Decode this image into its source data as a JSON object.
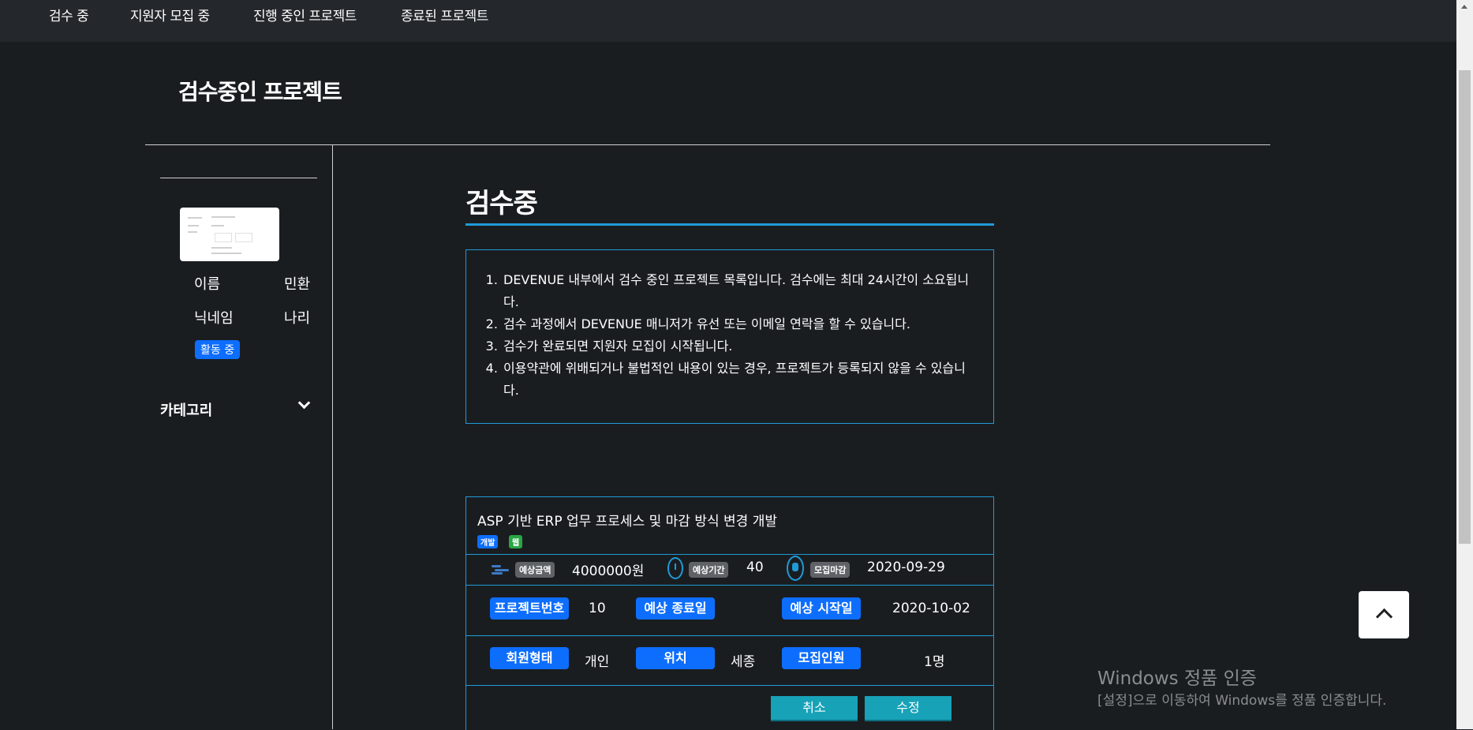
{
  "nav": {
    "items": [
      "검수 중",
      "지원자 모집 중",
      "진행 중인 프로젝트",
      "종료된 프로젝트"
    ]
  },
  "page": {
    "title": "검수중인 프로젝트"
  },
  "sidebar": {
    "profile": {
      "name_label": "이름",
      "name_value": "민환",
      "nickname_label": "닉네임",
      "nickname_value": "나리",
      "status": "활동 중"
    },
    "category_label": "카테고리"
  },
  "main": {
    "heading": "검수중",
    "info_items": [
      "DEVENUE 내부에서 검수 중인 프로젝트 목록입니다. 검수에는 최대 24시간이 소요됩니다.",
      "검수 과정에서 DEVENUE 매니저가 유선 또는 이메일 연락을 할 수 있습니다.",
      "검수가 완료되면 지원자 모집이 시작됩니다.",
      "이용약관에 위배되거나 불법적인 내용이 있는 경우, 프로젝트가 등록되지 않을 수 있습니다."
    ]
  },
  "project": {
    "title": "ASP 기반 ERP 업무 프로세스 및 마감 방식 변경 개발",
    "tags": [
      "개발",
      "웹"
    ],
    "budget_label": "예상금액",
    "budget_value": "4000000원",
    "duration_label": "예상기간",
    "duration_value": "40",
    "deadline_label": "모집마감",
    "deadline_value": "2020-09-29",
    "project_no_label": "프로젝트번호",
    "project_no_value": "10",
    "end_date_label": "예상 종료일",
    "end_date_value": "",
    "start_date_label": "예상 시작일",
    "start_date_value": "2020-10-02",
    "member_type_label": "회원형태",
    "member_type_value": "개인",
    "location_label": "위치",
    "location_value": "세종",
    "recruits_label": "모집인원",
    "recruits_value": "1명",
    "cancel_label": "취소",
    "edit_label": "수정"
  },
  "windows_notice": {
    "title": "Windows 정품 인증",
    "subtitle": "[설정]으로 이동하여 Windows를 정품 인증합니다."
  },
  "colors": {
    "background": "#1a1d20",
    "accent": "#1f9bd8",
    "primary": "#0d6efd",
    "button": "#17a2b8"
  }
}
